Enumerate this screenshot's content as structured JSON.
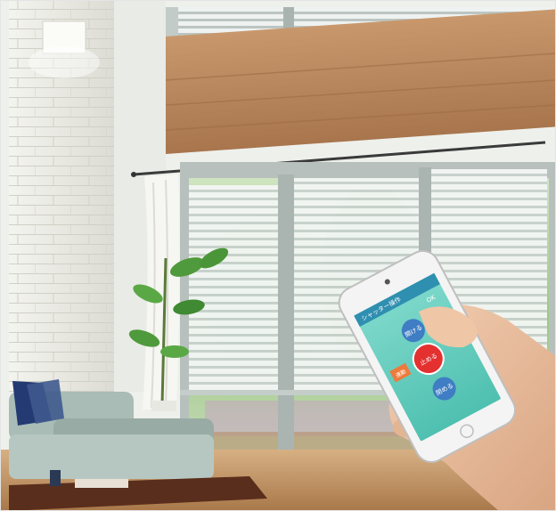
{
  "photo": {
    "subject": "living room with motorized horizontal window shutters",
    "colors": {
      "wall_stone": "#e6e6df",
      "wood_panel": "#b4835a",
      "window_frame": "#b9c2bf",
      "slat": "#eef2f1",
      "greenery": "#6faa53",
      "sofa": "#9fb3ad",
      "floor": "#c49a6c",
      "phone_screen": "#5fcfc0",
      "phone_center_button": "#e53030",
      "phone_side_button": "#ee7a3b",
      "phone_round_button": "#3f7dc4"
    }
  },
  "phone_app": {
    "header_text": "シャッター操作",
    "status_text": "OK",
    "button_open": "開ける",
    "button_stop": "止める",
    "button_close": "閉める",
    "button_side": "連動"
  }
}
